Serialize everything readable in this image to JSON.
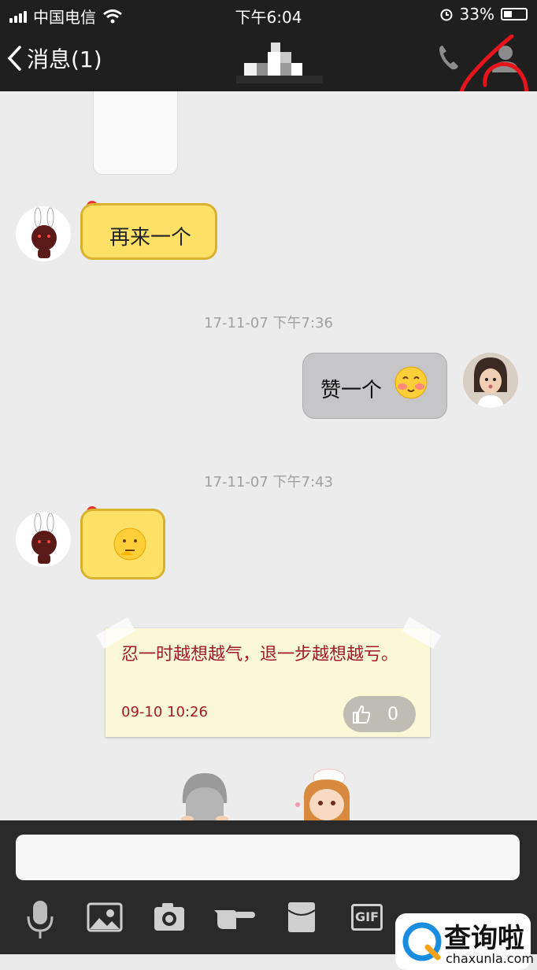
{
  "status_bar": {
    "carrier": "中国电信",
    "time": "下午6:04",
    "battery": "33%"
  },
  "nav": {
    "back_label": "消息(1)"
  },
  "messages": {
    "m1_text": "再来一个",
    "ts1": "17-11-07 下午7:36",
    "m2_text": "赞一个",
    "ts2": "17-11-07 下午7:43"
  },
  "note": {
    "text": "忍一时越想越气，退一步越想越亏。",
    "date": "09-10 10:26",
    "likes": "0"
  },
  "toolbar": {
    "gif_label": "GIF"
  },
  "watermark": {
    "brand": "查询啦",
    "domain": "chaxunla.com"
  },
  "colors": {
    "bubble_yellow": "#ffe168",
    "note_text": "#a3192a",
    "annotation": "#e8141c"
  }
}
